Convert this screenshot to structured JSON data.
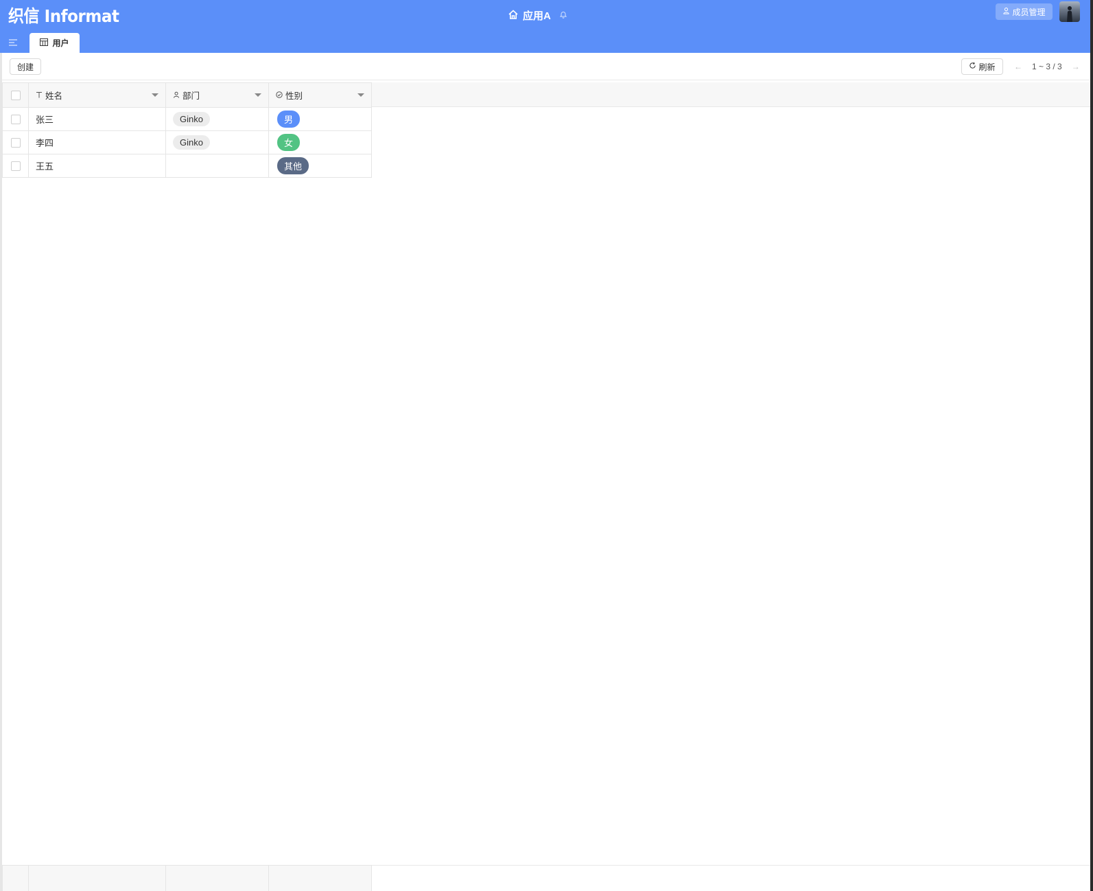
{
  "app": {
    "logo_text": "织信 Informat",
    "title": "应用A",
    "member_button_label": "成员管理"
  },
  "tabs": [
    {
      "label": "用户"
    }
  ],
  "toolbar": {
    "create_label": "创建",
    "refresh_label": "刷新",
    "pagination_text": "1 ~ 3 / 3"
  },
  "table": {
    "columns": [
      {
        "label": "姓名",
        "icon": "text-type-icon"
      },
      {
        "label": "部门",
        "icon": "user-icon"
      },
      {
        "label": "性别",
        "icon": "check-circle-icon"
      }
    ],
    "rows": [
      {
        "name": "张三",
        "dept": "Ginko",
        "gender": "男",
        "gender_color": "#5b8ff9"
      },
      {
        "name": "李四",
        "dept": "Ginko",
        "gender": "女",
        "gender_color": "#52c383"
      },
      {
        "name": "王五",
        "dept": "",
        "gender": "其他",
        "gender_color": "#5a6a86"
      }
    ]
  },
  "colors": {
    "header_bg": "#5b8ff9"
  }
}
